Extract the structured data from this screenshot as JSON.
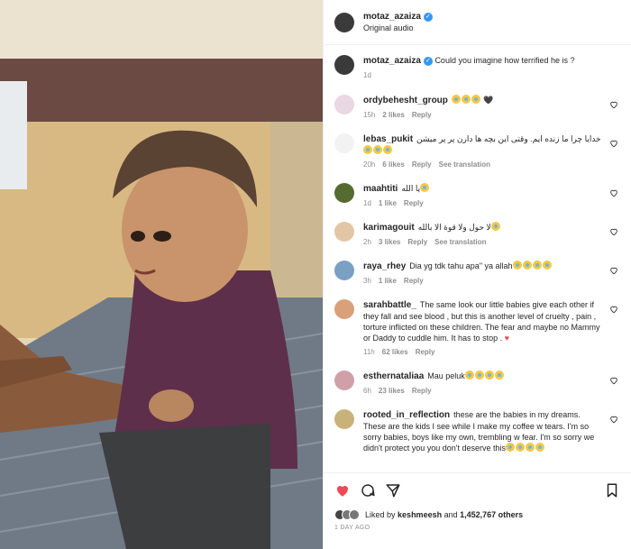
{
  "post": {
    "author": "motaz_azaiza",
    "audio": "Original audio",
    "caption": "Could you imagine how terrified he is ?",
    "caption_time": "1d"
  },
  "comments": [
    {
      "user": "ordybehesht_group",
      "text": "",
      "emoji_count": 3,
      "extra": "🖤",
      "time": "15h",
      "likes": "2 likes",
      "reply": "Reply",
      "translate": ""
    },
    {
      "user": "lebas_pukit",
      "text": "خدایا چرا ما زنده ایم. وقتی این بچه ها دارن پر پر میشن",
      "emoji_count": 3,
      "extra": "",
      "time": "20h",
      "likes": "6 likes",
      "reply": "Reply",
      "translate": "See translation"
    },
    {
      "user": "maahtiti",
      "text": "يا الله",
      "emoji_count": 1,
      "extra": "",
      "time": "1d",
      "likes": "1 like",
      "reply": "Reply",
      "translate": ""
    },
    {
      "user": "karimagouit",
      "text": "لا حول ولا قوة الا بالله",
      "emoji_count": 1,
      "extra": "",
      "time": "2h",
      "likes": "3 likes",
      "reply": "Reply",
      "translate": "See translation"
    },
    {
      "user": "raya_rhey",
      "text": "Dia yg tdk tahu apa\" ya allah",
      "emoji_count": 4,
      "extra": "",
      "time": "3h",
      "likes": "1 like",
      "reply": "Reply",
      "translate": ""
    },
    {
      "user": "sarahbattle_",
      "text": "The same look our little babies give each other if they fall and see blood , but this is another level of cruelty , pain , torture inflicted on these children. The fear and maybe no Mammy or Daddy to cuddle him. It has to stop .",
      "emoji_count": 0,
      "extra": "♥",
      "time": "11h",
      "likes": "62 likes",
      "reply": "Reply",
      "translate": ""
    },
    {
      "user": "esthernataliaa",
      "text": "Mau peluk",
      "emoji_count": 4,
      "extra": "",
      "time": "6h",
      "likes": "23 likes",
      "reply": "Reply",
      "translate": ""
    },
    {
      "user": "rooted_in_reflection",
      "text": "these are the babies in my dreams. These are the kids I see while I make my coffee w tears. I'm so sorry babies, boys like my own, trembling w fear. I'm so sorry we didn't protect you you don't deserve this",
      "emoji_count": 4,
      "extra": "",
      "time": "",
      "likes": "",
      "reply": "",
      "translate": ""
    }
  ],
  "footer": {
    "liked_by_prefix": "Liked by",
    "liked_by_user": "keshmeesh",
    "liked_by_and": "and",
    "liked_count": "1,452,767 others",
    "date": "1 DAY AGO"
  },
  "colors": {
    "heart": "#ed4956",
    "verified": "#3897f0",
    "muted": "#8e8e8e"
  }
}
